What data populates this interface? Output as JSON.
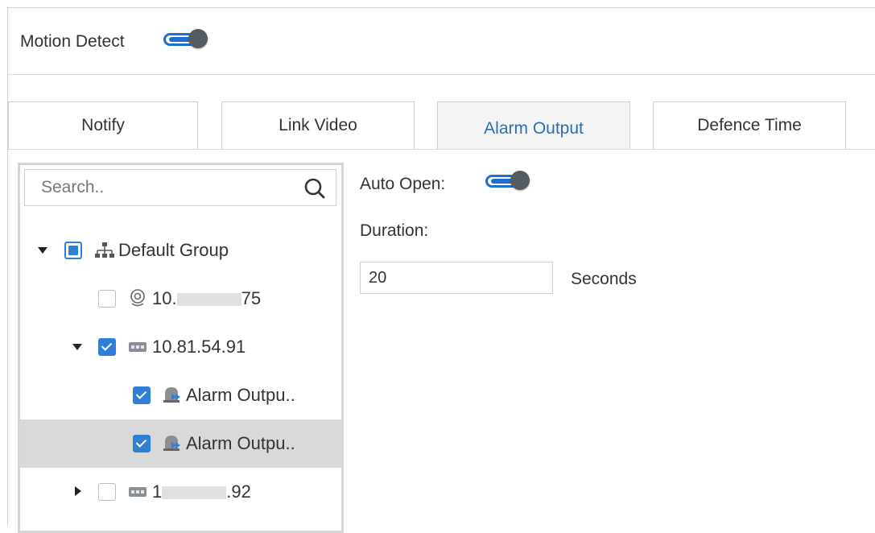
{
  "header": {
    "title": "Motion Detect",
    "toggle_on": true
  },
  "tabs": [
    {
      "label": "Notify",
      "active": false
    },
    {
      "label": "Link Video",
      "active": false
    },
    {
      "label": "Alarm Output",
      "active": true
    },
    {
      "label": "Defence Time",
      "active": false
    }
  ],
  "tree": {
    "search_placeholder": "Search..",
    "items": [
      {
        "label": "Default Group",
        "state": "partial",
        "expanded": true,
        "icon": "org-tree-icon"
      },
      {
        "label_prefix": "10.",
        "label_suffix": "75",
        "state": "unchecked",
        "icon": "camera-icon"
      },
      {
        "label": "10.81.54.91",
        "state": "checked",
        "expanded": true,
        "icon": "nvr-device-icon"
      },
      {
        "label": "Alarm Outpu..",
        "state": "checked",
        "icon": "alarm-output-icon"
      },
      {
        "label": "Alarm Outpu..",
        "state": "checked",
        "selected": true,
        "icon": "alarm-output-icon"
      },
      {
        "label_prefix": "1",
        "label_suffix": ".92",
        "state": "unchecked",
        "expanded": false,
        "icon": "nvr-device-icon"
      }
    ]
  },
  "settings": {
    "auto_open_label": "Auto Open:",
    "auto_open_on": true,
    "duration_label": "Duration:",
    "duration_value": "20",
    "duration_unit": "Seconds"
  },
  "colors": {
    "accent": "#1f6ecf",
    "checkbox": "#2f7fd6",
    "active_tab_text": "#2a6fb5",
    "selected_row": "#d9d9d9"
  }
}
